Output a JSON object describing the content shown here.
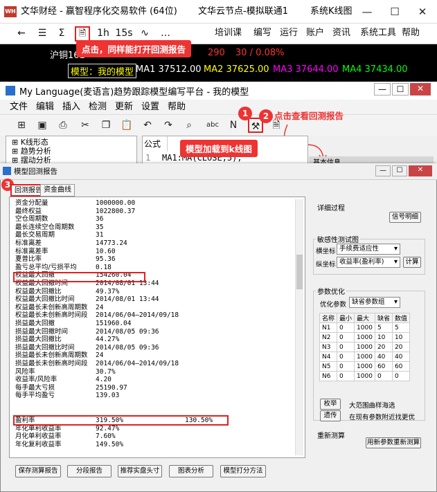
{
  "main_window": {
    "title": "文华财经 - 赢智程序化交易软件 (64位)",
    "node": "文华云节点-模拟联通1",
    "page": "系统K线图",
    "logo": "WH"
  },
  "main_toolbar": {
    "buttons": [
      "←",
      "☰",
      "Σ",
      "1h",
      "15s",
      "∿",
      "…"
    ],
    "menu": [
      "培训课",
      "编写",
      "运行",
      "账户",
      "资讯",
      "系统工具",
      "帮助"
    ]
  },
  "quote_bar": {
    "contract": "沪铜161",
    "price_fragment": "290",
    "change": "30 / 0.08%",
    "model_label": "模型：我的模型",
    "ma": [
      {
        "name": "MA1",
        "value": "37512.00",
        "color": "#ffffff"
      },
      {
        "name": "MA2",
        "value": "37625.00",
        "color": "#ffff00"
      },
      {
        "name": "MA3",
        "value": "37644.00",
        "color": "#ff00ff"
      },
      {
        "name": "MA4",
        "value": "37434.00",
        "color": "#00ff00"
      }
    ]
  },
  "editor": {
    "title": "My Language(麦语言)趋势跟踪模型编写平台 - 我的模型",
    "menu": [
      "文件",
      "编辑",
      "插入",
      "检测",
      "更新",
      "设置",
      "帮助"
    ],
    "tree": [
      "K线形态",
      "趋势分析",
      "摆动分析"
    ],
    "tab": "公式",
    "code_line": "1",
    "code": "MA1:MA(CLOSE,5);",
    "side_label": "基本信息"
  },
  "report": {
    "title": "模型回测报告",
    "tabs": [
      "回测报告",
      "资金曲线"
    ],
    "rows": [
      {
        "label": "资金分配量",
        "v": "1000000.00"
      },
      {
        "label": "最终权益",
        "v": "1022800.37"
      },
      {
        "label": "空仓周期数",
        "v": "36"
      },
      {
        "label": "最长连续空仓周期数",
        "v": "35"
      },
      {
        "label": "最长交易周期",
        "v": "31"
      },
      {
        "label": "标准离差",
        "v": "14773.24"
      },
      {
        "label": "标准离差率",
        "v": "10.60"
      },
      {
        "label": "夏普比率",
        "v": "95.36"
      },
      {
        "label": "盈亏总平均/亏损平均",
        "v": "0.18"
      },
      {
        "label": "权益最大回撤",
        "v": "154260.04"
      },
      {
        "label": "权益最大回撤时间",
        "v": "2014/08/01 13:44"
      },
      {
        "label": "权益最大回撤比",
        "v": "49.37%"
      },
      {
        "label": "权益最大回撤比时间",
        "v": "2014/08/01 13:44"
      },
      {
        "label": "权益最长未创新高周期数",
        "v": "24"
      },
      {
        "label": "权益最长未创新高时间段",
        "v": "2014/06/04—2014/09/18"
      },
      {
        "label": "损益最大回撤",
        "v": "151960.04"
      },
      {
        "label": "损益最大回撤时间",
        "v": "2014/08/05 09:36"
      },
      {
        "label": "损益最大回撤比",
        "v": "44.27%"
      },
      {
        "label": "损益最大回撤比时间",
        "v": "2014/08/05 09:36"
      },
      {
        "label": "损益最长未创新高周期数",
        "v": "24"
      },
      {
        "label": "损益最长未创新高时间段",
        "v": "2014/06/04—2014/09/18"
      },
      {
        "label": "风险率",
        "v": "30.7%"
      },
      {
        "label": "收益率/风险率",
        "v": "4.20"
      },
      {
        "label": "每手最大亏损",
        "v": "25190.97"
      },
      {
        "label": "每手平均盈亏",
        "v": "139.03"
      }
    ],
    "rows2": [
      {
        "label": "盈利率",
        "v": "319.50%",
        "v2": "130.50%"
      },
      {
        "label": "年化单利收益率",
        "v": "92.47%"
      },
      {
        "label": "月化单利收益率",
        "v": "7.60%"
      },
      {
        "label": "年化复利收益率",
        "v": "149.50%"
      }
    ],
    "bottom_buttons": [
      "保存测算报告",
      "分段报告",
      "推荐实盘头寸",
      "图表分析",
      "模型打分方法"
    ],
    "detail": {
      "title": "详细过程",
      "button": "信号明细"
    },
    "sensitivity": {
      "title": "敏感性测试图",
      "x_label": "横坐标",
      "x_value": "手续费适应性",
      "y_label": "纵坐标",
      "y_value": "收益率(盈利率)",
      "calc": "计算"
    },
    "param": {
      "title": "参数优化",
      "opt_label": "优化参数",
      "opt_value": "缺省参数组",
      "headers": [
        "名称",
        "最小",
        "最大",
        "缺省",
        "数值"
      ],
      "rows": [
        [
          "N1",
          "0",
          "1000",
          "5",
          "5"
        ],
        [
          "N2",
          "0",
          "1000",
          "10",
          "10"
        ],
        [
          "N3",
          "0",
          "1000",
          "20",
          "20"
        ],
        [
          "N4",
          "0",
          "1000",
          "40",
          "40"
        ],
        [
          "N5",
          "0",
          "1000",
          "60",
          "60"
        ],
        [
          "N6",
          "0",
          "1000",
          "0",
          "0"
        ]
      ],
      "b1": "枚举",
      "b1_text": "大范围曲样海选",
      "b2": "遗传",
      "b2_text": "在现有参数附近找更优"
    },
    "retest": {
      "title": "重新测算",
      "button": "用新参数重新测算"
    }
  },
  "callouts": {
    "c1": "点击，同样能打开回测报告",
    "c2": "点击查看回测报告",
    "c3": "模型加载到k线图",
    "n1": "1",
    "n2": "2",
    "n3": "3"
  },
  "colors": {
    "red": "#e33333",
    "chart_bg": "#000000"
  }
}
